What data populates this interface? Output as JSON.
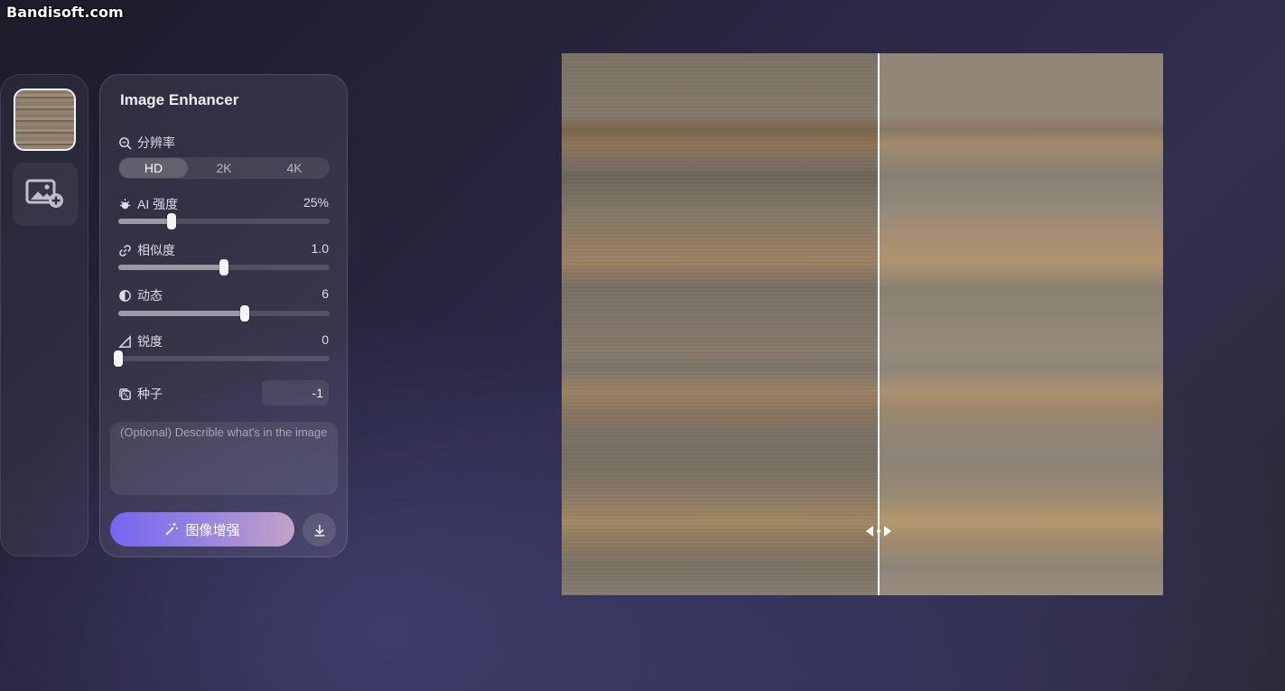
{
  "watermark": "Bandisoft.com",
  "panel": {
    "title": "Image Enhancer",
    "resolution": {
      "label": "分辨率",
      "options": [
        "HD",
        "2K",
        "4K"
      ],
      "selected": "HD"
    },
    "ai_strength": {
      "label": "AI 强度",
      "value": "25%",
      "fraction": 0.25
    },
    "similarity": {
      "label": "相似度",
      "value": "1.0",
      "fraction": 0.5
    },
    "dynamic": {
      "label": "动态",
      "value": "6",
      "fraction": 0.6
    },
    "sharpness": {
      "label": "锐度",
      "value": "0",
      "fraction": 0.0
    },
    "seed": {
      "label": "种子",
      "value": "-1"
    },
    "description": {
      "placeholder": "(Optional) Describle what's in the image"
    },
    "enhance_button": "图像增强"
  },
  "compare": {
    "split_fraction": 0.527
  }
}
